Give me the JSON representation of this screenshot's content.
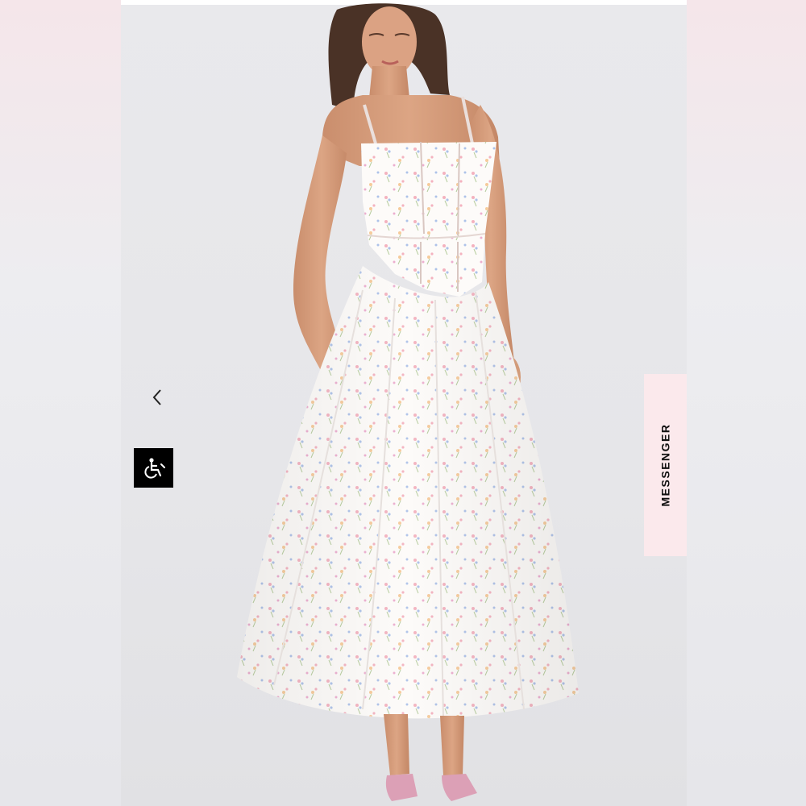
{
  "viewer": {
    "prev_icon": "chevron-left-icon",
    "accessibility_icon": "wheelchair-icon",
    "accessibility_bg": "#000000"
  },
  "messenger": {
    "label": "MESSENGER",
    "bg": "#fbe9ec"
  },
  "photo": {
    "subject": "product-photo-floral-midi-dress"
  }
}
